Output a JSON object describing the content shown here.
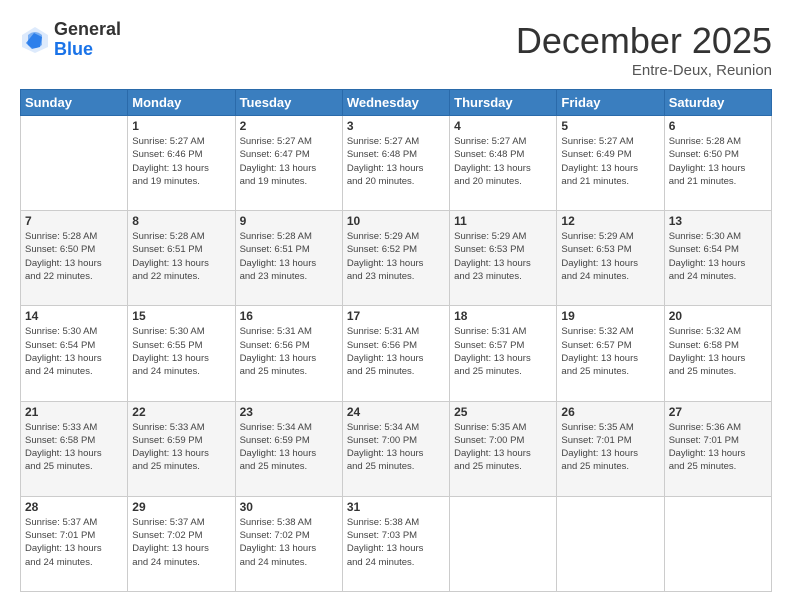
{
  "header": {
    "logo_general": "General",
    "logo_blue": "Blue",
    "month": "December 2025",
    "location": "Entre-Deux, Reunion"
  },
  "days_of_week": [
    "Sunday",
    "Monday",
    "Tuesday",
    "Wednesday",
    "Thursday",
    "Friday",
    "Saturday"
  ],
  "weeks": [
    [
      {
        "day": "",
        "info": ""
      },
      {
        "day": "1",
        "info": "Sunrise: 5:27 AM\nSunset: 6:46 PM\nDaylight: 13 hours\nand 19 minutes."
      },
      {
        "day": "2",
        "info": "Sunrise: 5:27 AM\nSunset: 6:47 PM\nDaylight: 13 hours\nand 19 minutes."
      },
      {
        "day": "3",
        "info": "Sunrise: 5:27 AM\nSunset: 6:48 PM\nDaylight: 13 hours\nand 20 minutes."
      },
      {
        "day": "4",
        "info": "Sunrise: 5:27 AM\nSunset: 6:48 PM\nDaylight: 13 hours\nand 20 minutes."
      },
      {
        "day": "5",
        "info": "Sunrise: 5:27 AM\nSunset: 6:49 PM\nDaylight: 13 hours\nand 21 minutes."
      },
      {
        "day": "6",
        "info": "Sunrise: 5:28 AM\nSunset: 6:50 PM\nDaylight: 13 hours\nand 21 minutes."
      }
    ],
    [
      {
        "day": "7",
        "info": "Sunrise: 5:28 AM\nSunset: 6:50 PM\nDaylight: 13 hours\nand 22 minutes."
      },
      {
        "day": "8",
        "info": "Sunrise: 5:28 AM\nSunset: 6:51 PM\nDaylight: 13 hours\nand 22 minutes."
      },
      {
        "day": "9",
        "info": "Sunrise: 5:28 AM\nSunset: 6:51 PM\nDaylight: 13 hours\nand 23 minutes."
      },
      {
        "day": "10",
        "info": "Sunrise: 5:29 AM\nSunset: 6:52 PM\nDaylight: 13 hours\nand 23 minutes."
      },
      {
        "day": "11",
        "info": "Sunrise: 5:29 AM\nSunset: 6:53 PM\nDaylight: 13 hours\nand 23 minutes."
      },
      {
        "day": "12",
        "info": "Sunrise: 5:29 AM\nSunset: 6:53 PM\nDaylight: 13 hours\nand 24 minutes."
      },
      {
        "day": "13",
        "info": "Sunrise: 5:30 AM\nSunset: 6:54 PM\nDaylight: 13 hours\nand 24 minutes."
      }
    ],
    [
      {
        "day": "14",
        "info": "Sunrise: 5:30 AM\nSunset: 6:54 PM\nDaylight: 13 hours\nand 24 minutes."
      },
      {
        "day": "15",
        "info": "Sunrise: 5:30 AM\nSunset: 6:55 PM\nDaylight: 13 hours\nand 24 minutes."
      },
      {
        "day": "16",
        "info": "Sunrise: 5:31 AM\nSunset: 6:56 PM\nDaylight: 13 hours\nand 25 minutes."
      },
      {
        "day": "17",
        "info": "Sunrise: 5:31 AM\nSunset: 6:56 PM\nDaylight: 13 hours\nand 25 minutes."
      },
      {
        "day": "18",
        "info": "Sunrise: 5:31 AM\nSunset: 6:57 PM\nDaylight: 13 hours\nand 25 minutes."
      },
      {
        "day": "19",
        "info": "Sunrise: 5:32 AM\nSunset: 6:57 PM\nDaylight: 13 hours\nand 25 minutes."
      },
      {
        "day": "20",
        "info": "Sunrise: 5:32 AM\nSunset: 6:58 PM\nDaylight: 13 hours\nand 25 minutes."
      }
    ],
    [
      {
        "day": "21",
        "info": "Sunrise: 5:33 AM\nSunset: 6:58 PM\nDaylight: 13 hours\nand 25 minutes."
      },
      {
        "day": "22",
        "info": "Sunrise: 5:33 AM\nSunset: 6:59 PM\nDaylight: 13 hours\nand 25 minutes."
      },
      {
        "day": "23",
        "info": "Sunrise: 5:34 AM\nSunset: 6:59 PM\nDaylight: 13 hours\nand 25 minutes."
      },
      {
        "day": "24",
        "info": "Sunrise: 5:34 AM\nSunset: 7:00 PM\nDaylight: 13 hours\nand 25 minutes."
      },
      {
        "day": "25",
        "info": "Sunrise: 5:35 AM\nSunset: 7:00 PM\nDaylight: 13 hours\nand 25 minutes."
      },
      {
        "day": "26",
        "info": "Sunrise: 5:35 AM\nSunset: 7:01 PM\nDaylight: 13 hours\nand 25 minutes."
      },
      {
        "day": "27",
        "info": "Sunrise: 5:36 AM\nSunset: 7:01 PM\nDaylight: 13 hours\nand 25 minutes."
      }
    ],
    [
      {
        "day": "28",
        "info": "Sunrise: 5:37 AM\nSunset: 7:01 PM\nDaylight: 13 hours\nand 24 minutes."
      },
      {
        "day": "29",
        "info": "Sunrise: 5:37 AM\nSunset: 7:02 PM\nDaylight: 13 hours\nand 24 minutes."
      },
      {
        "day": "30",
        "info": "Sunrise: 5:38 AM\nSunset: 7:02 PM\nDaylight: 13 hours\nand 24 minutes."
      },
      {
        "day": "31",
        "info": "Sunrise: 5:38 AM\nSunset: 7:03 PM\nDaylight: 13 hours\nand 24 minutes."
      },
      {
        "day": "",
        "info": ""
      },
      {
        "day": "",
        "info": ""
      },
      {
        "day": "",
        "info": ""
      }
    ]
  ]
}
